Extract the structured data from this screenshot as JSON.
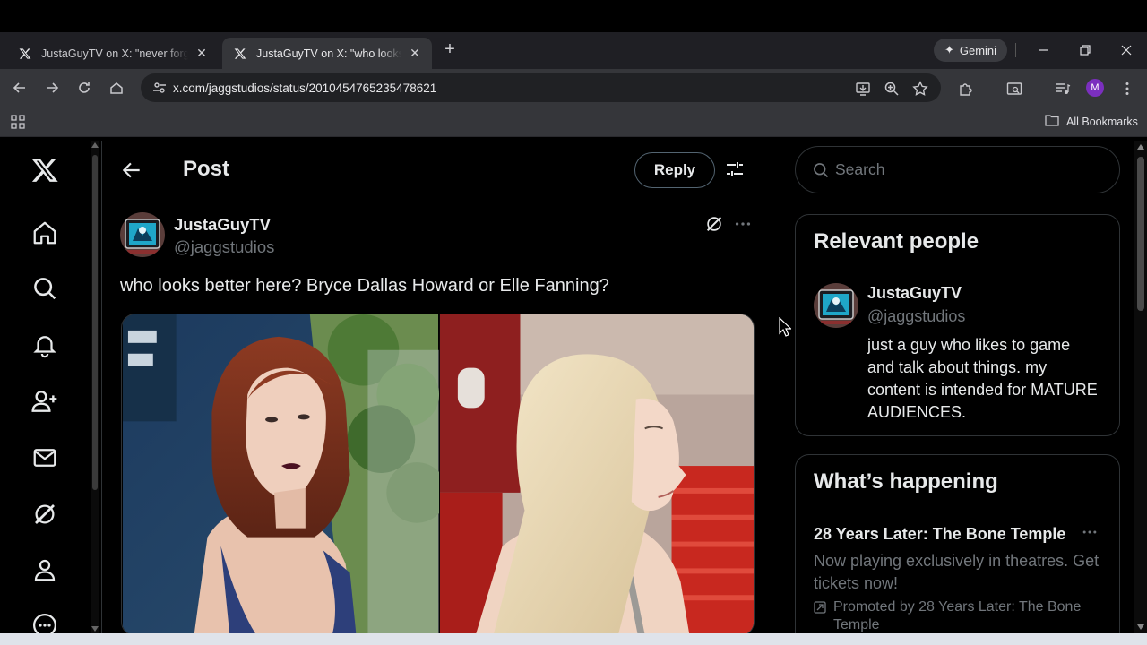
{
  "browser": {
    "tabs": [
      {
        "title": "JustaGuyTV on X: \"never forget",
        "active": false,
        "icon": "x-logo-icon"
      },
      {
        "title": "JustaGuyTV on X: \"who looks be",
        "active": true,
        "icon": "x-logo-icon"
      }
    ],
    "gemini_label": "Gemini",
    "url": "x.com/jaggstudios/status/2010454765235478621",
    "profile_initial": "M",
    "bookmarks_label": "All Bookmarks",
    "accent": "#7b2fbf"
  },
  "header": {
    "title": "Post",
    "reply_label": "Reply"
  },
  "post": {
    "author_name": "JustaGuyTV",
    "author_handle": "@jaggstudios",
    "text": "who looks better here? Bryce Dallas Howard or Elle Fanning?"
  },
  "sidebar": {
    "search_placeholder": "Search",
    "relevant_people": {
      "heading": "Relevant people",
      "name": "JustaGuyTV",
      "handle": "@jaggstudios",
      "bio": "just a guy who likes to game and talk about things. my content is intended for MATURE AUDIENCES."
    },
    "whats_happening": {
      "heading": "What’s happening",
      "trend_title": "28 Years Later: The Bone Temple",
      "trend_desc": "Now playing exclusively in theatres. Get tickets now!",
      "promoted": "Promoted by 28 Years Later: The Bone Temple"
    }
  },
  "colors": {
    "background": "#000000",
    "text": "#e7e9ea",
    "muted": "#71767b",
    "border": "#2f3336"
  }
}
